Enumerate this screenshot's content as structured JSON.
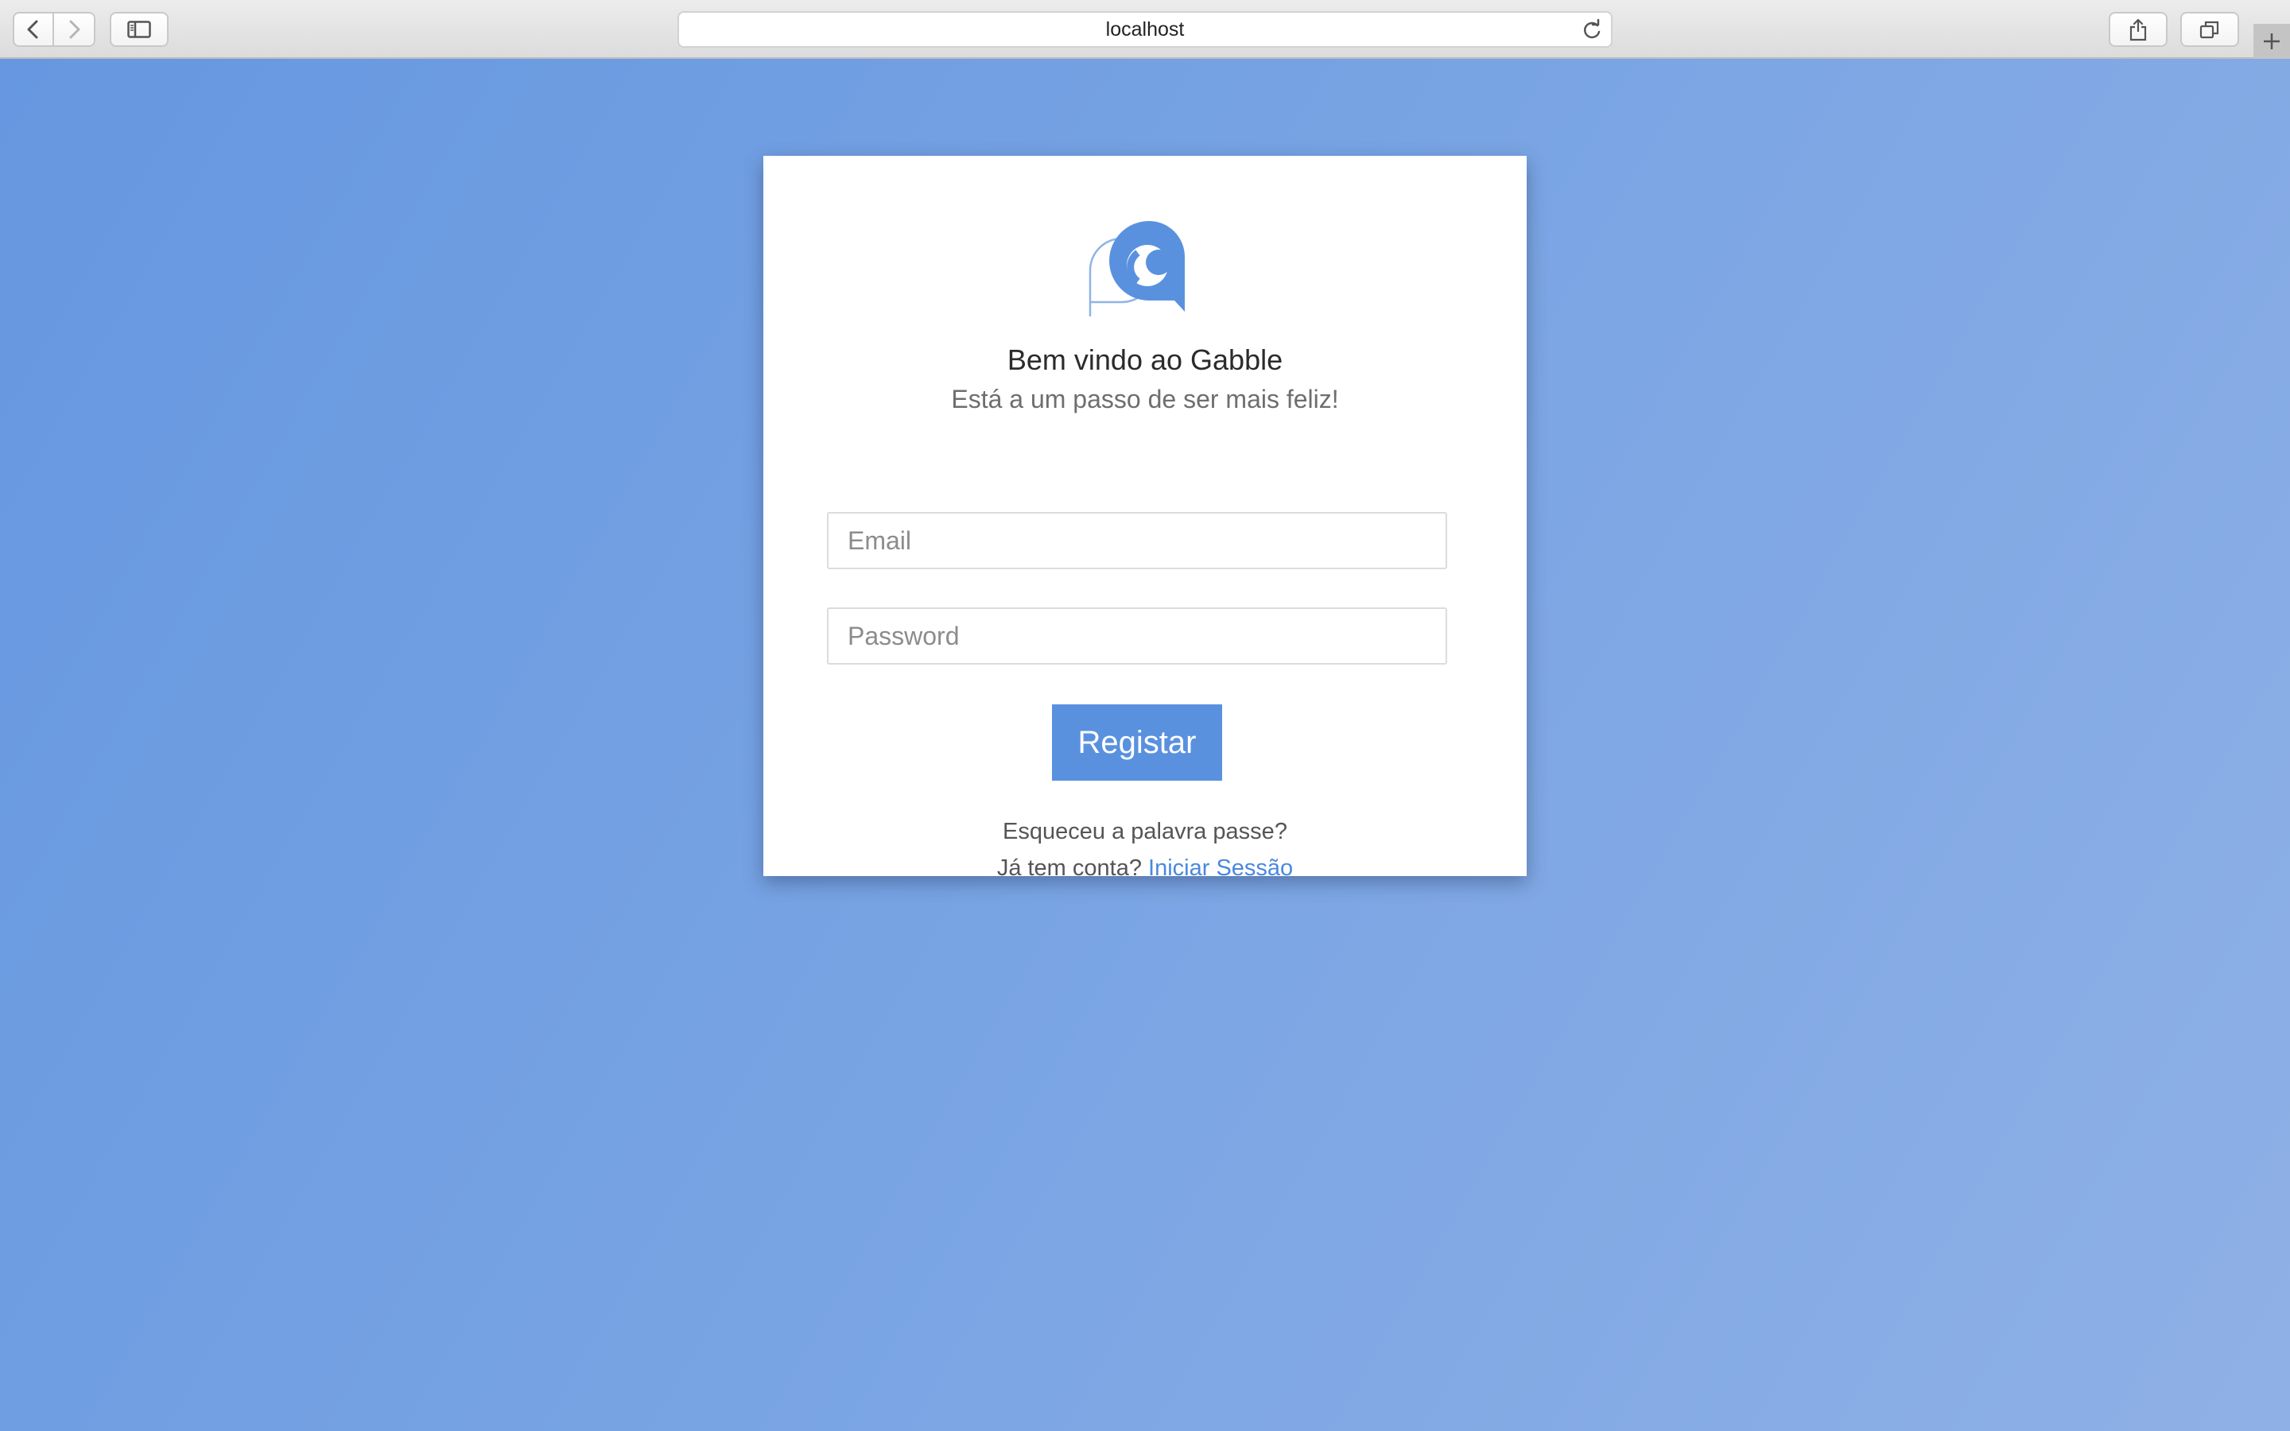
{
  "browser": {
    "url": "localhost"
  },
  "page": {
    "title": "Bem vindo ao Gabble",
    "subtitle": "Está a um passo de ser mais feliz!",
    "email_placeholder": "Email",
    "password_placeholder": "Password",
    "submit_label": "Registar",
    "forgot_label": "Esqueceu a palavra passe?",
    "have_account_label": "Já tem conta?",
    "login_link_label": "Iniciar Sessão"
  },
  "colors": {
    "accent": "#5a91df",
    "link": "#4a88df",
    "background_start": "#6697e0",
    "background_end": "#8fb0e6"
  }
}
